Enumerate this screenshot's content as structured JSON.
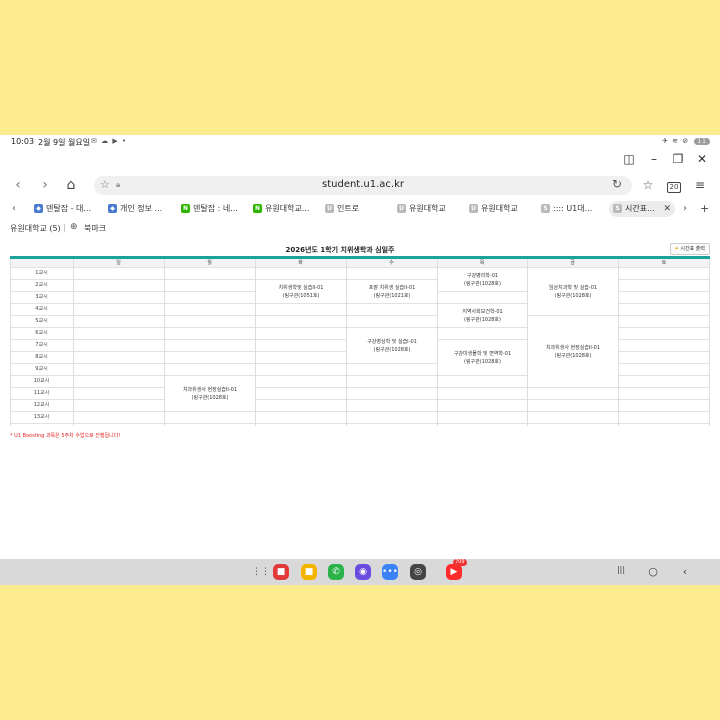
{
  "statusbar": {
    "time": "10:03",
    "date": "2월 9일 월요일",
    "app_icons": "✉ ☁ ▶ •",
    "right_icons": "✈ ≋ ⊘",
    "battery": "11"
  },
  "browser": {
    "url": "student.u1.ac.kr",
    "tab_count": "20",
    "tabs": [
      {
        "label": "덴탈잡 - 대...",
        "icon": "dental",
        "color": "#4a7bd0"
      },
      {
        "label": "개인 정보 ...",
        "icon": "dental",
        "color": "#4a7bd0"
      },
      {
        "label": "덴탈잡 : 네...",
        "icon": "N",
        "color": "#2db400"
      },
      {
        "label": "유원대학교...",
        "icon": "N",
        "color": "#2db400"
      },
      {
        "label": "인트로",
        "icon": "U",
        "color": "#b9b9b9"
      },
      {
        "label": "유원대학교",
        "icon": "U",
        "color": "#b9b9b9"
      },
      {
        "label": "유원대학교",
        "icon": "U",
        "color": "#b9b9b9"
      },
      {
        "label": ":::: U1대...",
        "icon": "S",
        "color": "#b9b9b9"
      },
      {
        "label": "시간표...",
        "icon": "S",
        "color": "#b9b9b9",
        "active": true
      }
    ],
    "bookmarks": [
      {
        "label": "유원대학교 (5)"
      },
      {
        "label": "북마크"
      }
    ]
  },
  "page": {
    "title": "2026년도 1학기 치위생학과  심일주",
    "print_label": "시간표 출력",
    "days": [
      "일",
      "월",
      "화",
      "수",
      "목",
      "금",
      "토"
    ],
    "periods": [
      "1교시",
      "2교시",
      "3교시",
      "4교시",
      "5교시",
      "6교시",
      "7교시",
      "8교시",
      "9교시",
      "10교시",
      "11교시",
      "12교시",
      "13교시"
    ],
    "courses": [
      {
        "day": 2,
        "start": 1,
        "end": 3,
        "name": "치위생학및 실습II-01",
        "room": "(링구관(1051호)"
      },
      {
        "day": 3,
        "start": 1,
        "end": 3,
        "name": "포괄 치위생 실습II-01",
        "room": "(링구관(1021호)"
      },
      {
        "day": 4,
        "start": 0,
        "end": 2,
        "name": "구강병리학-01",
        "room": "(링구관(1028호)"
      },
      {
        "day": 5,
        "start": 0,
        "end": 4,
        "name": "임상치과학 및 실습-01",
        "room": "(링구관(1028호)"
      },
      {
        "day": 4,
        "start": 3,
        "end": 5,
        "name": "지역사회보건학-01",
        "room": "(링구관(1028호)"
      },
      {
        "day": 3,
        "start": 5,
        "end": 8,
        "name": "구강영상학 및 실습I-01",
        "room": "(링구관(1028호)"
      },
      {
        "day": 4,
        "start": 6,
        "end": 9,
        "name": "구강미생물학 및 면역학-01",
        "room": "(링구관(1028호)"
      },
      {
        "day": 5,
        "start": 4,
        "end": 10,
        "name": "치과위생사 현장실습II-01",
        "room": "(링구관(1028호)"
      },
      {
        "day": 1,
        "start": 9,
        "end": 12,
        "name": "치과위생사 현장실습II-01",
        "room": "(링구관(1028호)"
      }
    ],
    "footnote": "* U1 Boosting 과목은 5주차 수업으로 진행됩니다!"
  },
  "taskbar": {
    "apps": [
      {
        "name": "apps-grid",
        "color": "#d9d9d9",
        "glyph": "⋮⋮"
      },
      {
        "name": "notes-app",
        "color": "#e23a3a",
        "glyph": "■"
      },
      {
        "name": "files-app",
        "color": "#f5b400",
        "glyph": "■"
      },
      {
        "name": "phone-app",
        "color": "#2bb34a",
        "glyph": "✆"
      },
      {
        "name": "browser-app",
        "color": "#6a4de0",
        "glyph": "◉"
      },
      {
        "name": "messages-app",
        "color": "#3b82f6",
        "glyph": "•••"
      },
      {
        "name": "camera-app",
        "color": "#444444",
        "glyph": "◎"
      },
      {
        "name": "youtube-app",
        "color": "#ff2a2a",
        "glyph": "▶"
      }
    ],
    "youtube_badge": "709"
  }
}
